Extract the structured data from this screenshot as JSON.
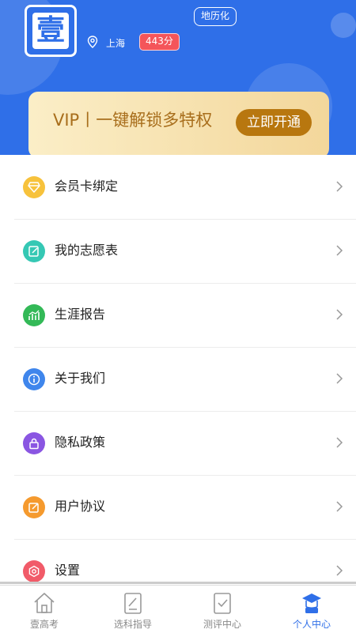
{
  "header": {
    "avatar_char": "壹",
    "subject": "地历化",
    "location": "上海",
    "score": "443分",
    "brand_color": "#2f6fe8"
  },
  "vip": {
    "text": "VIP丨一键解锁多特权",
    "button": "立即开通"
  },
  "menu": [
    {
      "label": "会员卡绑定",
      "icon": "diamond-icon",
      "color": "#f7c23c"
    },
    {
      "label": "我的志愿表",
      "icon": "edit-icon",
      "color": "#35c8b4"
    },
    {
      "label": "生涯报告",
      "icon": "chart-icon",
      "color": "#33b957"
    },
    {
      "label": "关于我们",
      "icon": "info-icon",
      "color": "#3f86ec"
    },
    {
      "label": "隐私政策",
      "icon": "lock-icon",
      "color": "#8a56e2"
    },
    {
      "label": "用户协议",
      "icon": "agreement-icon",
      "color": "#f59a2e"
    },
    {
      "label": "设置",
      "icon": "settings-icon",
      "color": "#f15b69"
    }
  ],
  "tabbar": {
    "active_color": "#2f6fe8",
    "items": [
      {
        "label": "壹高考",
        "icon": "home-icon"
      },
      {
        "label": "选科指导",
        "icon": "guide-icon"
      },
      {
        "label": "测评中心",
        "icon": "assessment-icon"
      },
      {
        "label": "个人中心",
        "icon": "profile-icon",
        "active": true
      }
    ]
  }
}
